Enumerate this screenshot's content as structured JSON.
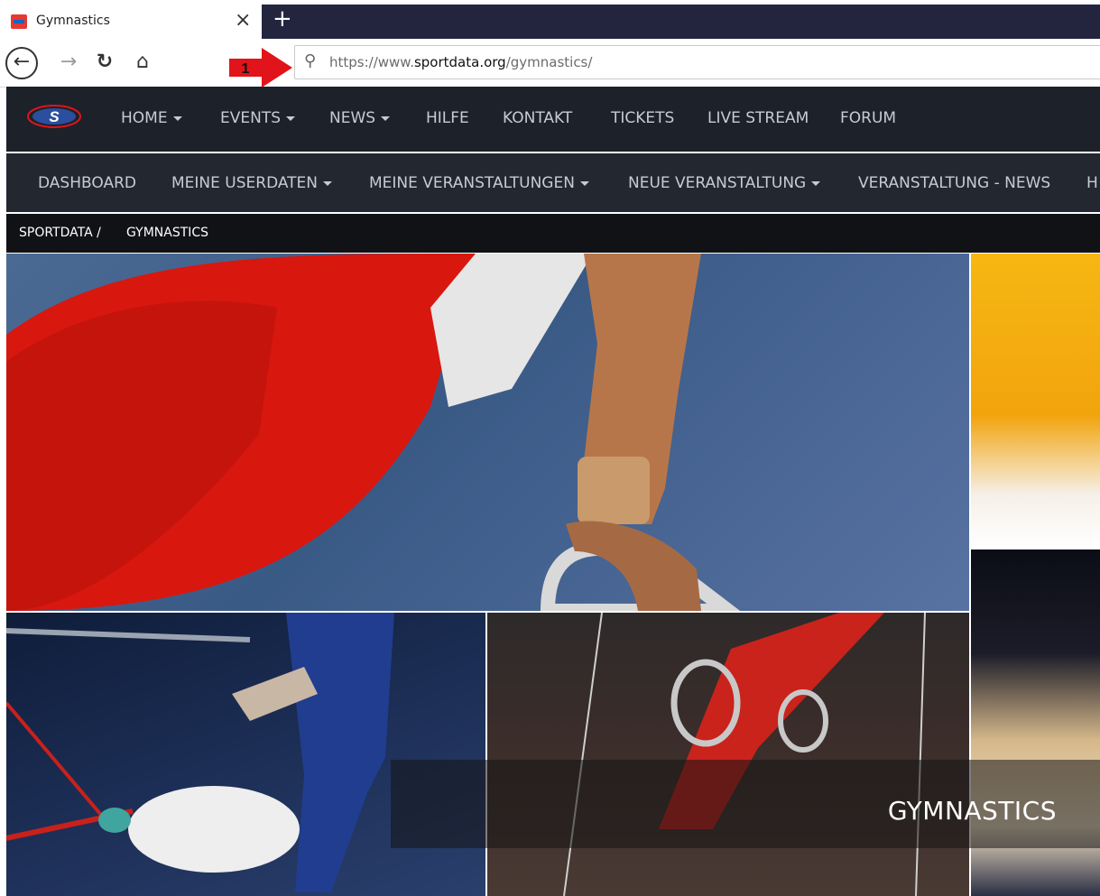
{
  "browser": {
    "tab": {
      "title": "Gymnastics",
      "close": "×"
    },
    "new_tab": "+",
    "url": {
      "prefix": "https://www.",
      "domain": "sportdata.org",
      "path": "/gymnastics/"
    },
    "annotation_marker": "1"
  },
  "main_nav": {
    "items": [
      {
        "label": "HOME",
        "dropdown": true
      },
      {
        "label": "EVENTS",
        "dropdown": true
      },
      {
        "label": "NEWS",
        "dropdown": true
      },
      {
        "label": "HILFE",
        "dropdown": false
      },
      {
        "label": "KONTAKT",
        "dropdown": false
      },
      {
        "label": "TICKETS",
        "dropdown": false
      },
      {
        "label": "LIVE STREAM",
        "dropdown": false
      },
      {
        "label": "FORUM",
        "dropdown": false
      }
    ]
  },
  "sub_nav": {
    "items": [
      {
        "label": "DASHBOARD",
        "dropdown": false
      },
      {
        "label": "MEINE USERDATEN",
        "dropdown": true
      },
      {
        "label": "MEINE VERANSTALTUNGEN",
        "dropdown": true
      },
      {
        "label": "NEUE VERANSTALTUNG",
        "dropdown": true
      },
      {
        "label": "VERANSTALTUNG - NEWS",
        "dropdown": false
      },
      {
        "label": "H",
        "dropdown": false
      }
    ]
  },
  "breadcrumb": {
    "root": "SPORTDATA /",
    "current": "GYMNASTICS"
  },
  "hero": {
    "caption": "GYMNASTICS"
  },
  "colors": {
    "nav_bg": "#1d2129",
    "subnav_bg": "#23272f",
    "marker_red": "#e0141a"
  }
}
